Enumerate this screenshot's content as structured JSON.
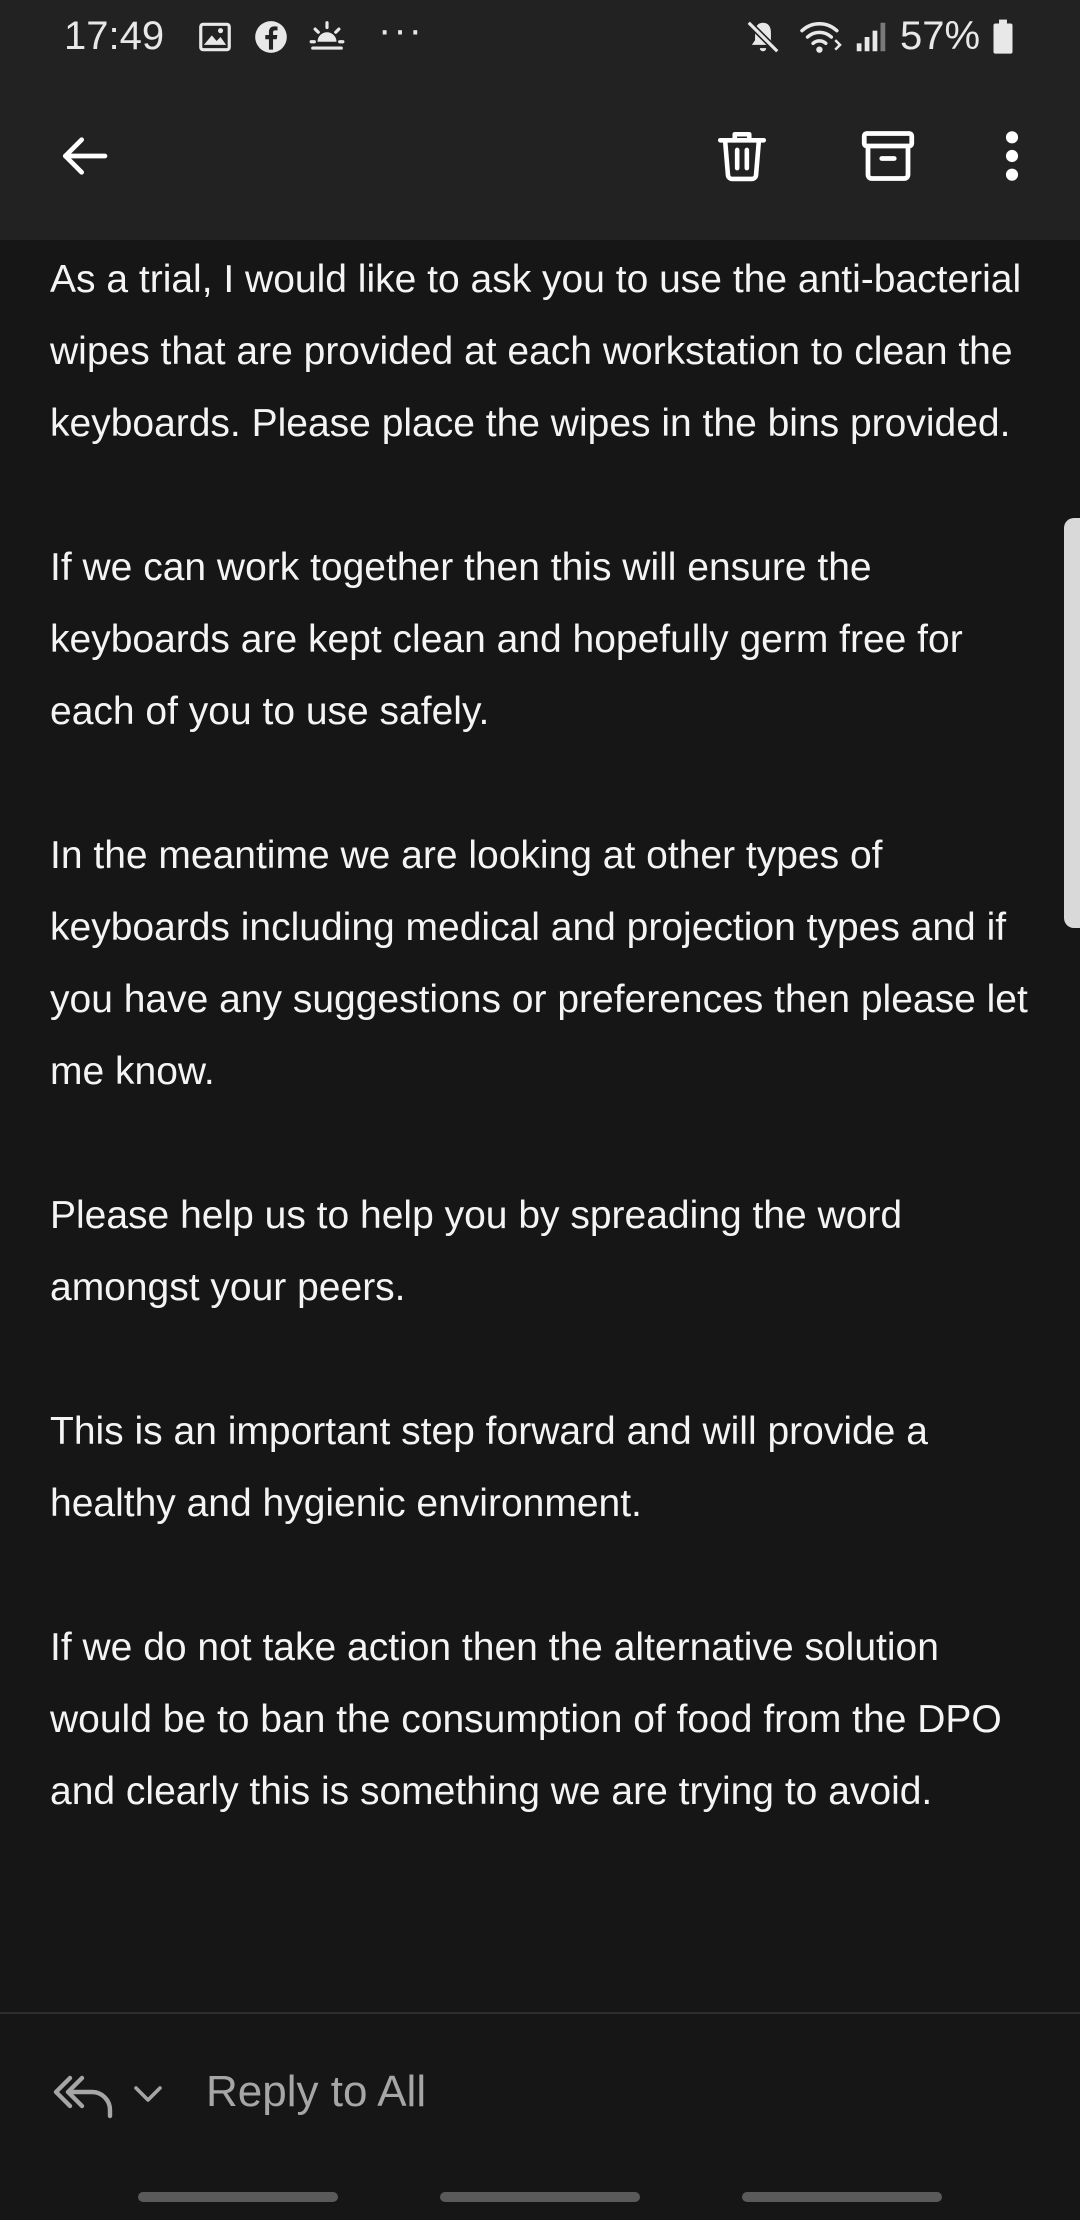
{
  "status_bar": {
    "time": "17:49",
    "notification_icons": [
      "gallery-icon",
      "facebook-icon",
      "weather-icon"
    ],
    "more_indicator": "···",
    "system_icons": [
      "mute-icon",
      "wifi-icon",
      "signal-icon",
      "battery-icon"
    ],
    "battery_percent": "57%"
  },
  "toolbar": {
    "icons": [
      "back-arrow-icon",
      "trash-icon",
      "archive-icon",
      "more-vertical-icon"
    ]
  },
  "email": {
    "paragraphs": [
      "As a trial, I would like to ask you to use the anti-bacterial wipes that are provided at each workstation to clean the keyboards. Please place the wipes in the bins provided.",
      "If we can work together then this will ensure the keyboards are kept clean and hopefully germ free for each of you to use safely.",
      "In the meantime we are looking at other types of keyboards including medical and projection types and if you have any suggestions or preferences then please let me know.",
      "Please help us to help you by spreading the word amongst your peers.",
      "This is an important step forward and will provide a healthy and hygienic environment.",
      "If we do not take action then the alternative solution would be to ban the consumption of food from the DPO and clearly this is something we are trying to avoid."
    ]
  },
  "reply_bar": {
    "label": "Reply to All",
    "icons": [
      "reply-all-icon",
      "chevron-down-icon"
    ]
  },
  "colors": {
    "background": "#161616",
    "toolbar": "#222222",
    "text": "#f4f4f4",
    "muted_text": "#a6a6a6"
  }
}
